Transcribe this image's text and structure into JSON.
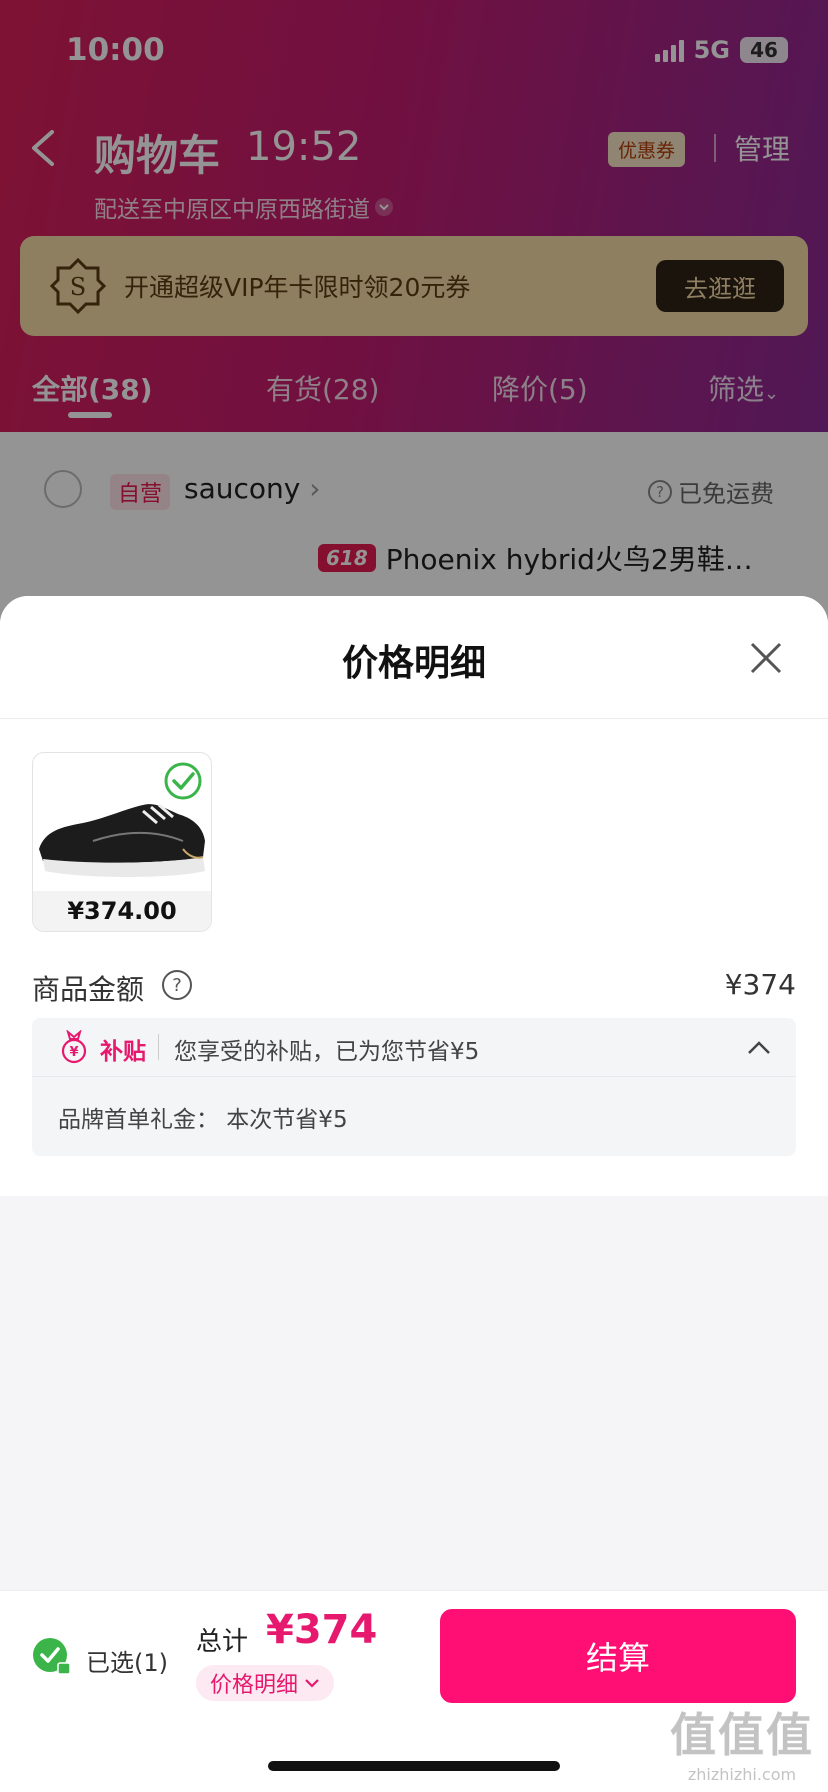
{
  "status_bar": {
    "time": "10:00",
    "network": "5G",
    "battery": "46"
  },
  "header": {
    "title": "购物车",
    "time": "19:52",
    "delivery": "配送至中原区中原西路街道",
    "coupon_label": "优惠券",
    "manage_label": "管理"
  },
  "vip_banner": {
    "text": "开通超级VIP年卡限时领20元券",
    "button": "去逛逛"
  },
  "tabs": [
    {
      "label": "全部(38)"
    },
    {
      "label": "有货(28)"
    },
    {
      "label": "降价(5)"
    },
    {
      "label": "筛选"
    }
  ],
  "store": {
    "badge": "自营",
    "name": "saucony",
    "shipping": "已免运费"
  },
  "product": {
    "promo_tag": "618",
    "title": "Phoenix hybrid火鸟2男鞋…"
  },
  "sheet": {
    "title": "价格明细",
    "item_price": "¥374.00",
    "amount_label": "商品金额",
    "amount_value": "¥374",
    "subsidy_tag": "补贴",
    "subsidy_text": "您享受的补贴，已为您节省¥5",
    "subsidy_detail": "品牌首单礼金：  本次节省¥5"
  },
  "bottom_bar": {
    "selected": "已选(1)",
    "total_label": "总计",
    "total_value": "¥374",
    "detail_label": "价格明细",
    "checkout": "结算"
  },
  "watermark": {
    "main": "值值值",
    "sub": "zhizhizhi.com"
  },
  "colors": {
    "accent": "#ff0f73",
    "price": "#e6196e",
    "check_green": "#3bb54a",
    "header_start": "#d91f5a",
    "header_end": "#8b2a95"
  },
  "icons": [
    "back-icon",
    "chevron-down-icon",
    "vip-coin-icon",
    "question-icon",
    "close-icon",
    "check-icon",
    "yuan-bag-icon",
    "chevron-up-icon"
  ]
}
